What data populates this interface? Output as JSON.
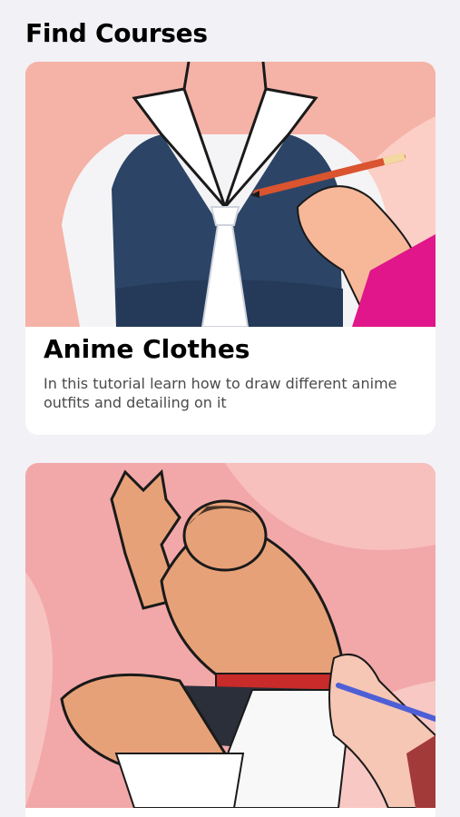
{
  "header": {
    "title": "Find Courses"
  },
  "courses": [
    {
      "title": "Anime Clothes",
      "description": "In this tutorial learn how to draw different anime outfits and detailing on it",
      "thumbnail_icon": "anime-clothes-illustration",
      "bg_color": "#f5b2a6"
    },
    {
      "thumbnail_icon": "muscle-fighter-illustration",
      "bg_color": "#f2a8a8"
    }
  ]
}
